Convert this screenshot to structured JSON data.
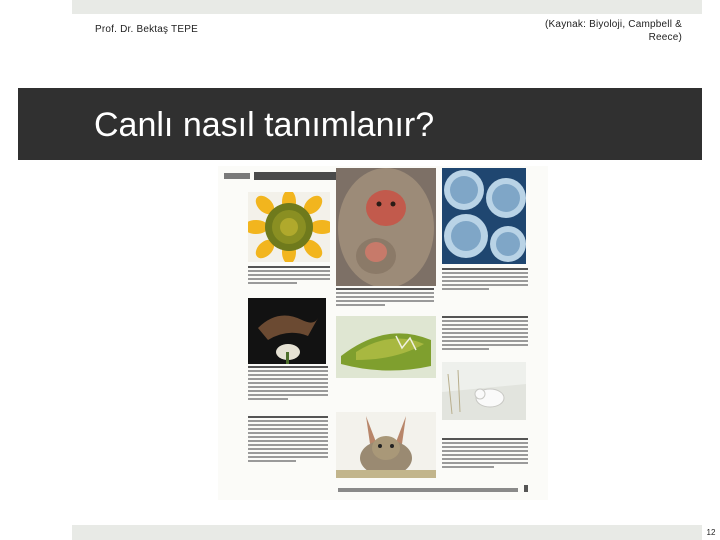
{
  "header": {
    "author": "Prof. Dr. Bektaş TEPE",
    "source": "(Kaynak: Biyoloji, Campbell & Reece)"
  },
  "slide": {
    "title": "Canlı nasıl tanımlanır?",
    "page_number": "12"
  },
  "colors": {
    "title_band": "#303030",
    "strip": "#e8eae6"
  },
  "figure": {
    "photos": [
      {
        "name": "sunflower-photo"
      },
      {
        "name": "macaque-photo"
      },
      {
        "name": "frog-eggs-photo"
      },
      {
        "name": "bat-flower-photo"
      },
      {
        "name": "venus-flytrap-photo"
      },
      {
        "name": "ptarmigan-snow-photo"
      },
      {
        "name": "jackrabbit-photo"
      }
    ]
  }
}
